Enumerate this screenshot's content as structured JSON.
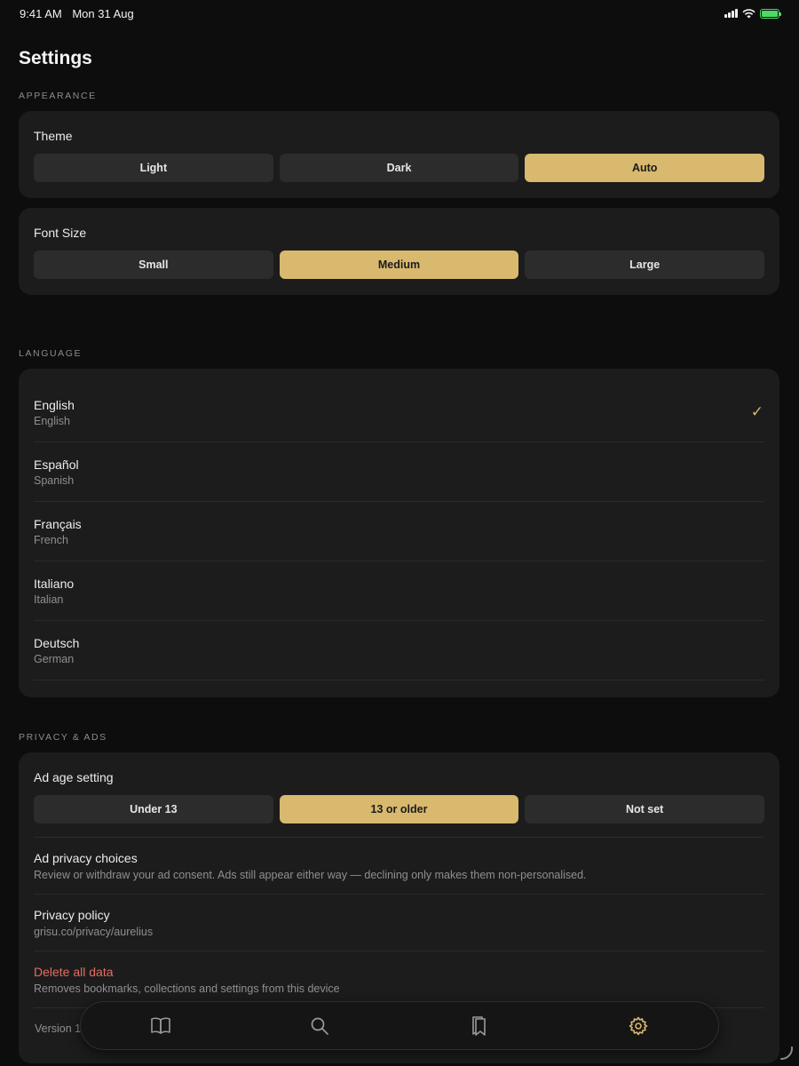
{
  "status": {
    "time": "9:41 AM",
    "date": "Mon 31 Aug"
  },
  "page": {
    "title": "Settings"
  },
  "appearance": {
    "label": "APPEARANCE",
    "theme": {
      "title": "Theme",
      "options": [
        "Light",
        "Dark",
        "Auto"
      ],
      "selected": "Auto"
    },
    "font_size": {
      "title": "Font Size",
      "options": [
        "Small",
        "Medium",
        "Large"
      ],
      "selected": "Medium"
    }
  },
  "language": {
    "label": "LANGUAGE",
    "items": [
      {
        "name": "English",
        "sub": "English"
      },
      {
        "name": "Español",
        "sub": "Spanish"
      },
      {
        "name": "Français",
        "sub": "French"
      },
      {
        "name": "Italiano",
        "sub": "Italian"
      },
      {
        "name": "Deutsch",
        "sub": "German"
      }
    ],
    "selected": "English"
  },
  "privacy": {
    "label": "PRIVACY & ADS",
    "ad_age": {
      "title": "Ad age setting",
      "options": [
        "Under 13",
        "13 or older",
        "Not set"
      ],
      "selected": "13 or older"
    },
    "ad_choices": {
      "title": "Ad privacy choices",
      "sub": "Review or withdraw your ad consent. Ads still appear either way — declining only makes them non-personalised."
    },
    "policy": {
      "title": "Privacy policy",
      "sub": "grisu.co/privacy/aurelius"
    },
    "delete": {
      "title": "Delete all data",
      "sub": "Removes bookmarks, collections and settings from this device"
    },
    "version": "Version 1"
  },
  "tabbar": {
    "icons": [
      "book-icon",
      "search-icon",
      "bookmarks-icon",
      "gear-icon"
    ],
    "active": "gear-icon"
  },
  "colors": {
    "accent": "#d8b96e",
    "background": "#0d0d0d",
    "card": "#1c1c1c",
    "danger": "#e86b61"
  }
}
